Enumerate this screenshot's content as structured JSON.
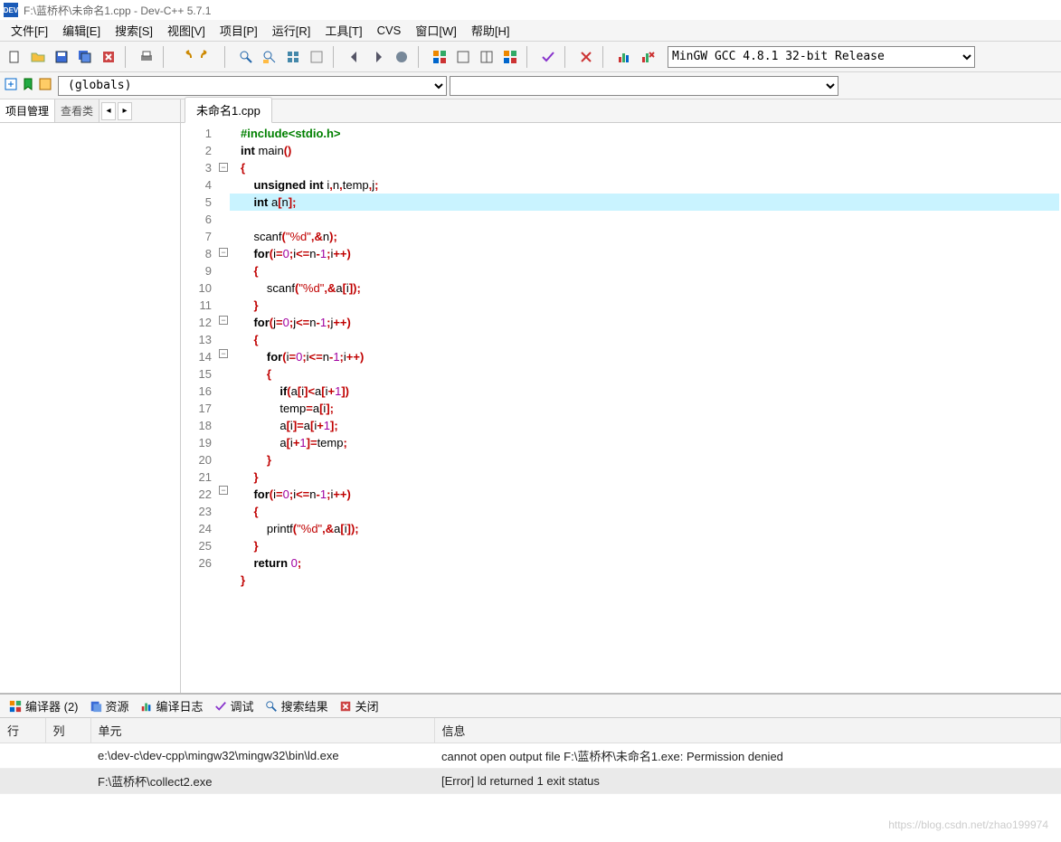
{
  "titlebar": {
    "icon_text": "DEV",
    "title": "F:\\蓝桥杯\\未命名1.cpp - Dev-C++ 5.7.1"
  },
  "menubar": {
    "items": [
      "文件[F]",
      "编辑[E]",
      "搜索[S]",
      "视图[V]",
      "项目[P]",
      "运行[R]",
      "工具[T]",
      "CVS",
      "窗口[W]",
      "帮助[H]"
    ]
  },
  "compiler_dropdown": {
    "selected": "MinGW GCC 4.8.1 32-bit Release"
  },
  "toolbar2": {
    "globals": "(globals)",
    "empty": ""
  },
  "left_panel": {
    "tabs": [
      "项目管理",
      "查看类"
    ],
    "nav_prev": "◂",
    "nav_next": "▸"
  },
  "file_tab": {
    "name": "未命名1.cpp"
  },
  "code": {
    "lines": [
      {
        "n": "1",
        "fold": "",
        "html": "<span class='pp'>#include&lt;stdio.h&gt;</span>"
      },
      {
        "n": "2",
        "fold": "",
        "html": "<span class='kw'>int</span> main<span class='br'>()</span>"
      },
      {
        "n": "3",
        "fold": "[-]",
        "html": "<span class='br'>{</span>"
      },
      {
        "n": "4",
        "fold": "",
        "html": "    <span class='kw'>unsigned</span> <span class='kw'>int</span> i<span class='br'>,</span>n<span class='br'>,</span>temp<span class='br'>,</span>j<span class='br'>;</span>"
      },
      {
        "n": "5",
        "fold": "",
        "hl": true,
        "html": "    <span class='kw'>int</span> a<span class='br'>[</span>n<span class='br'>];</span>"
      },
      {
        "n": "6",
        "fold": "",
        "html": "    scanf<span class='br'>(</span><span class='str'>\"%d\"</span><span class='br'>,&amp;</span>n<span class='br'>);</span>"
      },
      {
        "n": "7",
        "fold": "",
        "html": "    <span class='kw'>for</span><span class='br'>(</span>i<span class='br'>=</span><span class='num'>0</span><span class='br'>;</span>i<span class='br'>&lt;=</span>n<span class='br'>-</span><span class='num'>1</span><span class='br'>;</span>i<span class='br'>++)</span>"
      },
      {
        "n": "8",
        "fold": "[-]",
        "html": "    <span class='br'>{</span>"
      },
      {
        "n": "9",
        "fold": "",
        "html": "        scanf<span class='br'>(</span><span class='str'>\"%d\"</span><span class='br'>,&amp;</span>a<span class='br'>[</span>i<span class='br'>]);</span>"
      },
      {
        "n": "10",
        "fold": "",
        "html": "    <span class='br'>}</span>"
      },
      {
        "n": "11",
        "fold": "",
        "html": "    <span class='kw'>for</span><span class='br'>(</span>j<span class='br'>=</span><span class='num'>0</span><span class='br'>;</span>j<span class='br'>&lt;=</span>n<span class='br'>-</span><span class='num'>1</span><span class='br'>;</span>j<span class='br'>++)</span>"
      },
      {
        "n": "12",
        "fold": "[-]",
        "html": "    <span class='br'>{</span>"
      },
      {
        "n": "13",
        "fold": "",
        "html": "        <span class='kw'>for</span><span class='br'>(</span>i<span class='br'>=</span><span class='num'>0</span><span class='br'>;</span>i<span class='br'>&lt;=</span>n<span class='br'>-</span><span class='num'>1</span><span class='br'>;</span>i<span class='br'>++)</span>"
      },
      {
        "n": "14",
        "fold": "[-]",
        "html": "        <span class='br'>{</span>"
      },
      {
        "n": "15",
        "fold": "",
        "html": "            <span class='kw'>if</span><span class='br'>(</span>a<span class='br'>[</span>i<span class='br'>]&lt;</span>a<span class='br'>[</span>i<span class='br'>+</span><span class='num'>1</span><span class='br'>])</span>"
      },
      {
        "n": "16",
        "fold": "",
        "html": "            temp<span class='br'>=</span>a<span class='br'>[</span>i<span class='br'>];</span>"
      },
      {
        "n": "17",
        "fold": "",
        "html": "            a<span class='br'>[</span>i<span class='br'>]=</span>a<span class='br'>[</span>i<span class='br'>+</span><span class='num'>1</span><span class='br'>];</span>"
      },
      {
        "n": "18",
        "fold": "",
        "html": "            a<span class='br'>[</span>i<span class='br'>+</span><span class='num'>1</span><span class='br'>]=</span>temp<span class='br'>;</span>"
      },
      {
        "n": "19",
        "fold": "",
        "html": "        <span class='br'>}</span>"
      },
      {
        "n": "20",
        "fold": "",
        "html": "    <span class='br'>}</span>"
      },
      {
        "n": "21",
        "fold": "",
        "html": "    <span class='kw'>for</span><span class='br'>(</span>i<span class='br'>=</span><span class='num'>0</span><span class='br'>;</span>i<span class='br'>&lt;=</span>n<span class='br'>-</span><span class='num'>1</span><span class='br'>;</span>i<span class='br'>++)</span>"
      },
      {
        "n": "22",
        "fold": "[-]",
        "html": "    <span class='br'>{</span>"
      },
      {
        "n": "23",
        "fold": "",
        "html": "        printf<span class='br'>(</span><span class='str'>\"%d\"</span><span class='br'>,&amp;</span>a<span class='br'>[</span>i<span class='br'>]);</span>"
      },
      {
        "n": "24",
        "fold": "",
        "html": "    <span class='br'>}</span>"
      },
      {
        "n": "25",
        "fold": "",
        "html": "    <span class='kw'>return</span> <span class='num'>0</span><span class='br'>;</span>"
      },
      {
        "n": "26",
        "fold": "",
        "html": "<span class='br'>}</span>"
      }
    ]
  },
  "bottom": {
    "tabs": [
      "编译器 (2)",
      "资源",
      "编译日志",
      "调试",
      "搜索结果",
      "关闭"
    ],
    "cols": [
      "行",
      "列",
      "单元",
      "信息"
    ],
    "rows": [
      {
        "line": "",
        "col": "",
        "unit": "e:\\dev-c\\dev-cpp\\mingw32\\mingw32\\bin\\ld.exe",
        "msg": "cannot open output file F:\\蓝桥杯\\未命名1.exe: Permission denied"
      },
      {
        "line": "",
        "col": "",
        "unit": "F:\\蓝桥杯\\collect2.exe",
        "msg": "[Error] ld returned 1 exit status",
        "sel": true
      }
    ]
  },
  "watermark": "https://blog.csdn.net/zhao199974"
}
